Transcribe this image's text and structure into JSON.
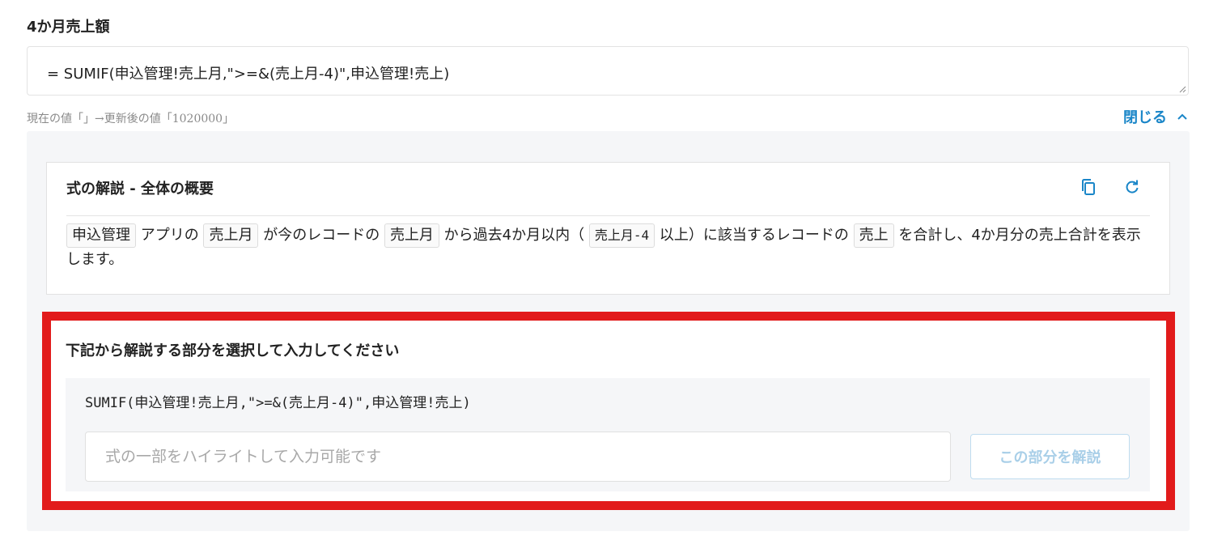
{
  "field": {
    "label": "4か月売上額",
    "formula": "= SUMIF(申込管理!売上月,\">=&(売上月-4)\",申込管理!売上)",
    "value_note": "現在の値「」→更新後の値「1020000」",
    "close_label": "閉じる",
    "close_icon": "chevron-up-icon"
  },
  "overview": {
    "title": "式の解説 - 全体の概要",
    "copy_icon": "copy-icon",
    "refresh_icon": "refresh-icon",
    "body": {
      "chip_app": "申込管理",
      "t1": "アプリの",
      "chip_field1": "売上月",
      "t2": "が今のレコードの",
      "chip_field2": "売上月",
      "t3": "から過去4か月以内（",
      "chip_expr": "売上月-4",
      "t4": "以上）に該当するレコードの",
      "chip_field3": "売上",
      "t5": "を合計し、4か月分の売上合計を表示します。"
    }
  },
  "select": {
    "title": "下記から解説する部分を選択して入力してください",
    "code": "SUMIF(申込管理!売上月,\">=&(売上月-4)\",申込管理!売上)",
    "input_placeholder": "式の一部をハイライトして入力可能です",
    "button_label": "この部分を解説",
    "frame_color": "#e21b1b"
  },
  "colors": {
    "accent": "#1a86c8",
    "panel_bg": "#f5f6f8"
  }
}
